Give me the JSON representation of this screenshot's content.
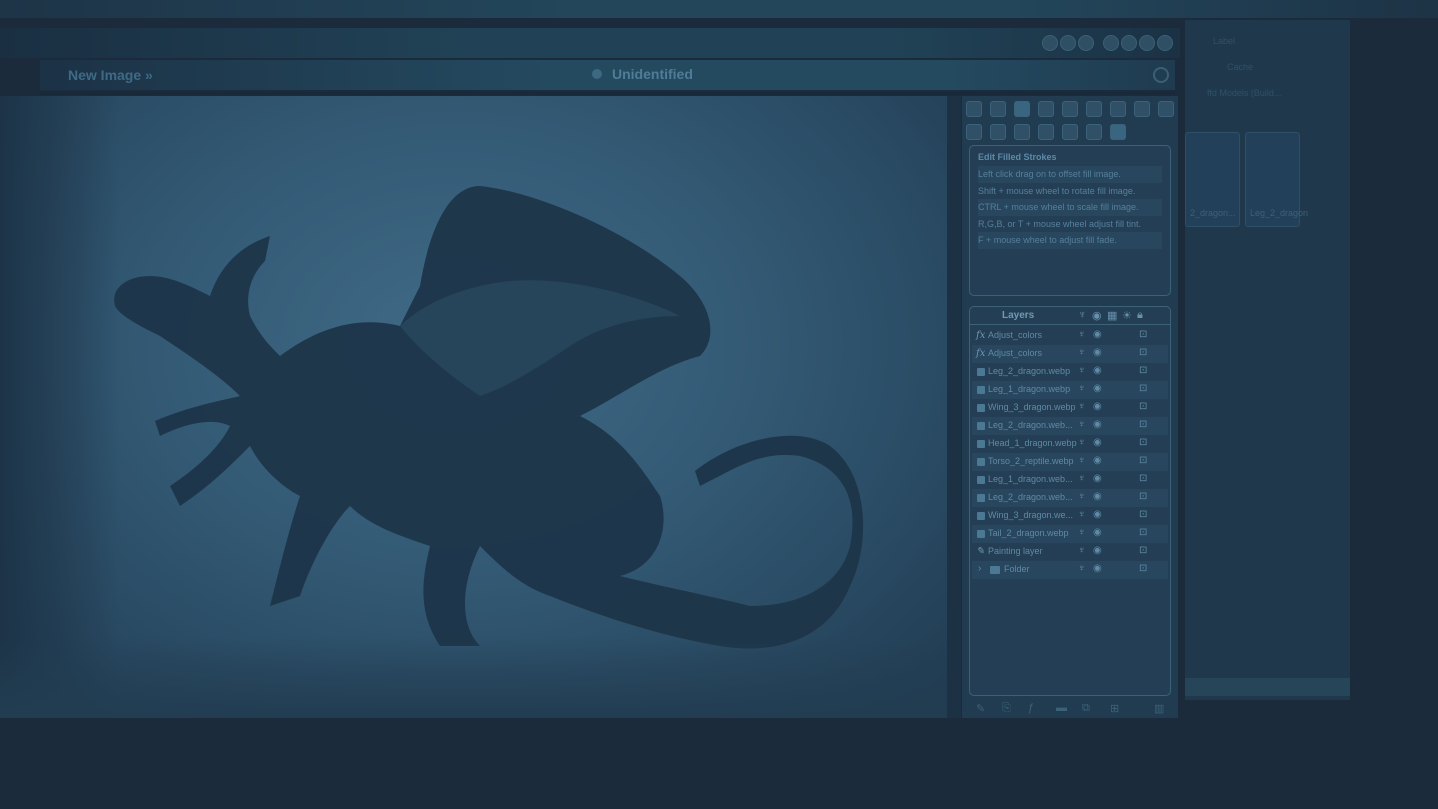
{
  "header": {
    "new_image": "New Image »",
    "document_title": "Unidentified"
  },
  "help": {
    "title": "Edit Filled Strokes",
    "lines": [
      "Left click drag on to offset fill image.",
      "Shift + mouse wheel to rotate fill image.",
      "CTRL + mouse wheel to scale fill image.",
      "R,G,B, or T + mouse wheel adjust fill tint.",
      "F + mouse wheel to adjust fill fade."
    ]
  },
  "layers": {
    "title": "Layers",
    "rows": [
      {
        "name": "Adjust_colors",
        "kind": "fx"
      },
      {
        "name": "Adjust_colors",
        "kind": "fx"
      },
      {
        "name": "Leg_2_dragon.webp",
        "kind": "image"
      },
      {
        "name": "Leg_1_dragon.webp",
        "kind": "image"
      },
      {
        "name": "Wing_3_dragon.webp",
        "kind": "image"
      },
      {
        "name": "Leg_2_dragon.web...",
        "kind": "image"
      },
      {
        "name": "Head_1_dragon.webp",
        "kind": "image"
      },
      {
        "name": "Torso_2_reptile.webp",
        "kind": "image"
      },
      {
        "name": "Leg_1_dragon.web...",
        "kind": "image"
      },
      {
        "name": "Leg_2_dragon.web...",
        "kind": "image"
      },
      {
        "name": "Wing_3_dragon.we...",
        "kind": "image"
      },
      {
        "name": "Tail_2_dragon.webp",
        "kind": "image"
      },
      {
        "name": "Painting layer",
        "kind": "paint"
      },
      {
        "name": "Folder",
        "kind": "folder"
      }
    ]
  },
  "background_window": {
    "label_1": "Label",
    "label_2": "Cache",
    "path": "ffd Models (Build...",
    "thumb_1": "2_dragon...",
    "thumb_2": "Leg_2_dragon"
  },
  "colors": {
    "accent": "#4f7c98",
    "panel": "#213c51"
  }
}
